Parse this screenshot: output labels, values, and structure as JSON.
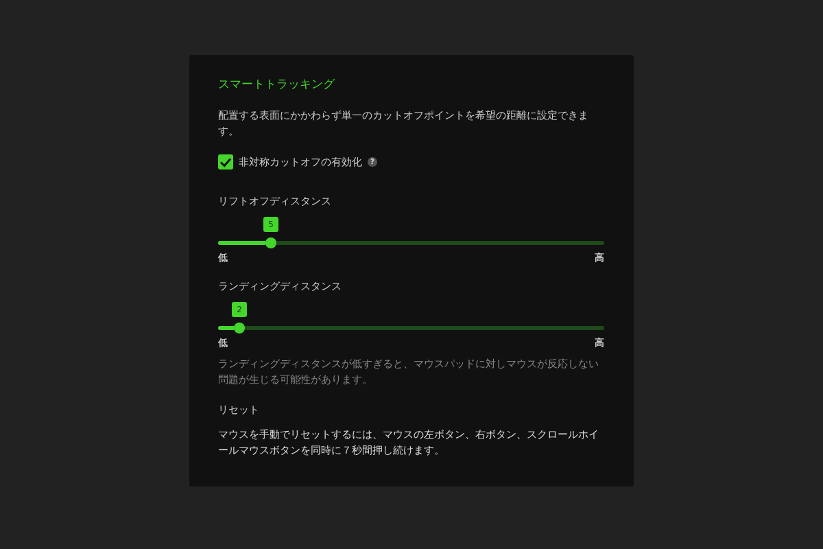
{
  "panel": {
    "title": "スマートトラッキング",
    "description": "配置する表面にかかわらず単一のカットオフポイントを希望の距離に設定できます。",
    "checkbox": {
      "label": "非対称カットオフの有効化",
      "checked": true,
      "help": "?"
    },
    "sliders": [
      {
        "label": "リフトオフディスタンス",
        "value": "5",
        "level": 0.137,
        "min_label": "低",
        "max_label": "高"
      },
      {
        "label": "ランディングディスタンス",
        "value": "2",
        "level": 0.055,
        "min_label": "低",
        "max_label": "高"
      }
    ],
    "warning": "ランディングディスタンスが低すぎると、マウスパッドに対しマウスが反応しない問題が生じる可能性があります。",
    "reset": {
      "heading": "リセット",
      "text": "マウスを手動でリセットするには、マウスの左ボタン、右ボタン、スクロールホイールマウスボタンを同時に７秒間押し続けます。"
    }
  }
}
